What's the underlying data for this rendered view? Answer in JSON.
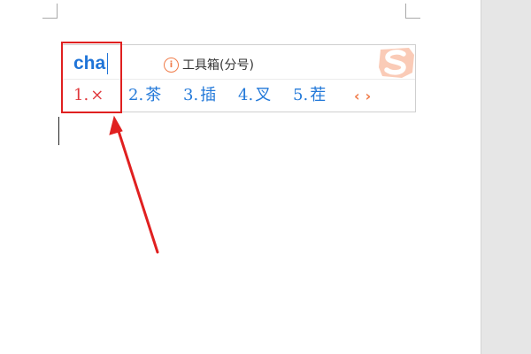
{
  "ime": {
    "pinyin": "cha",
    "toolbox_icon": "info-circle-icon",
    "toolbox_label": "工具箱(分号)",
    "logo": "sogou-s-logo",
    "candidates": [
      {
        "num": "1.",
        "text": "×"
      },
      {
        "num": "2.",
        "text": "茶"
      },
      {
        "num": "3.",
        "text": "插"
      },
      {
        "num": "4.",
        "text": "叉"
      },
      {
        "num": "5.",
        "text": "茬"
      }
    ],
    "prev_icon": "chevron-left-icon",
    "next_icon": "chevron-right-icon",
    "prev_glyph": "‹",
    "next_glyph": "›"
  },
  "annotation": {
    "highlight_color": "#e02020"
  },
  "colors": {
    "candidate_blue": "#2379d9",
    "selected_red": "#e0383c",
    "accent_orange": "#f07c4a"
  }
}
